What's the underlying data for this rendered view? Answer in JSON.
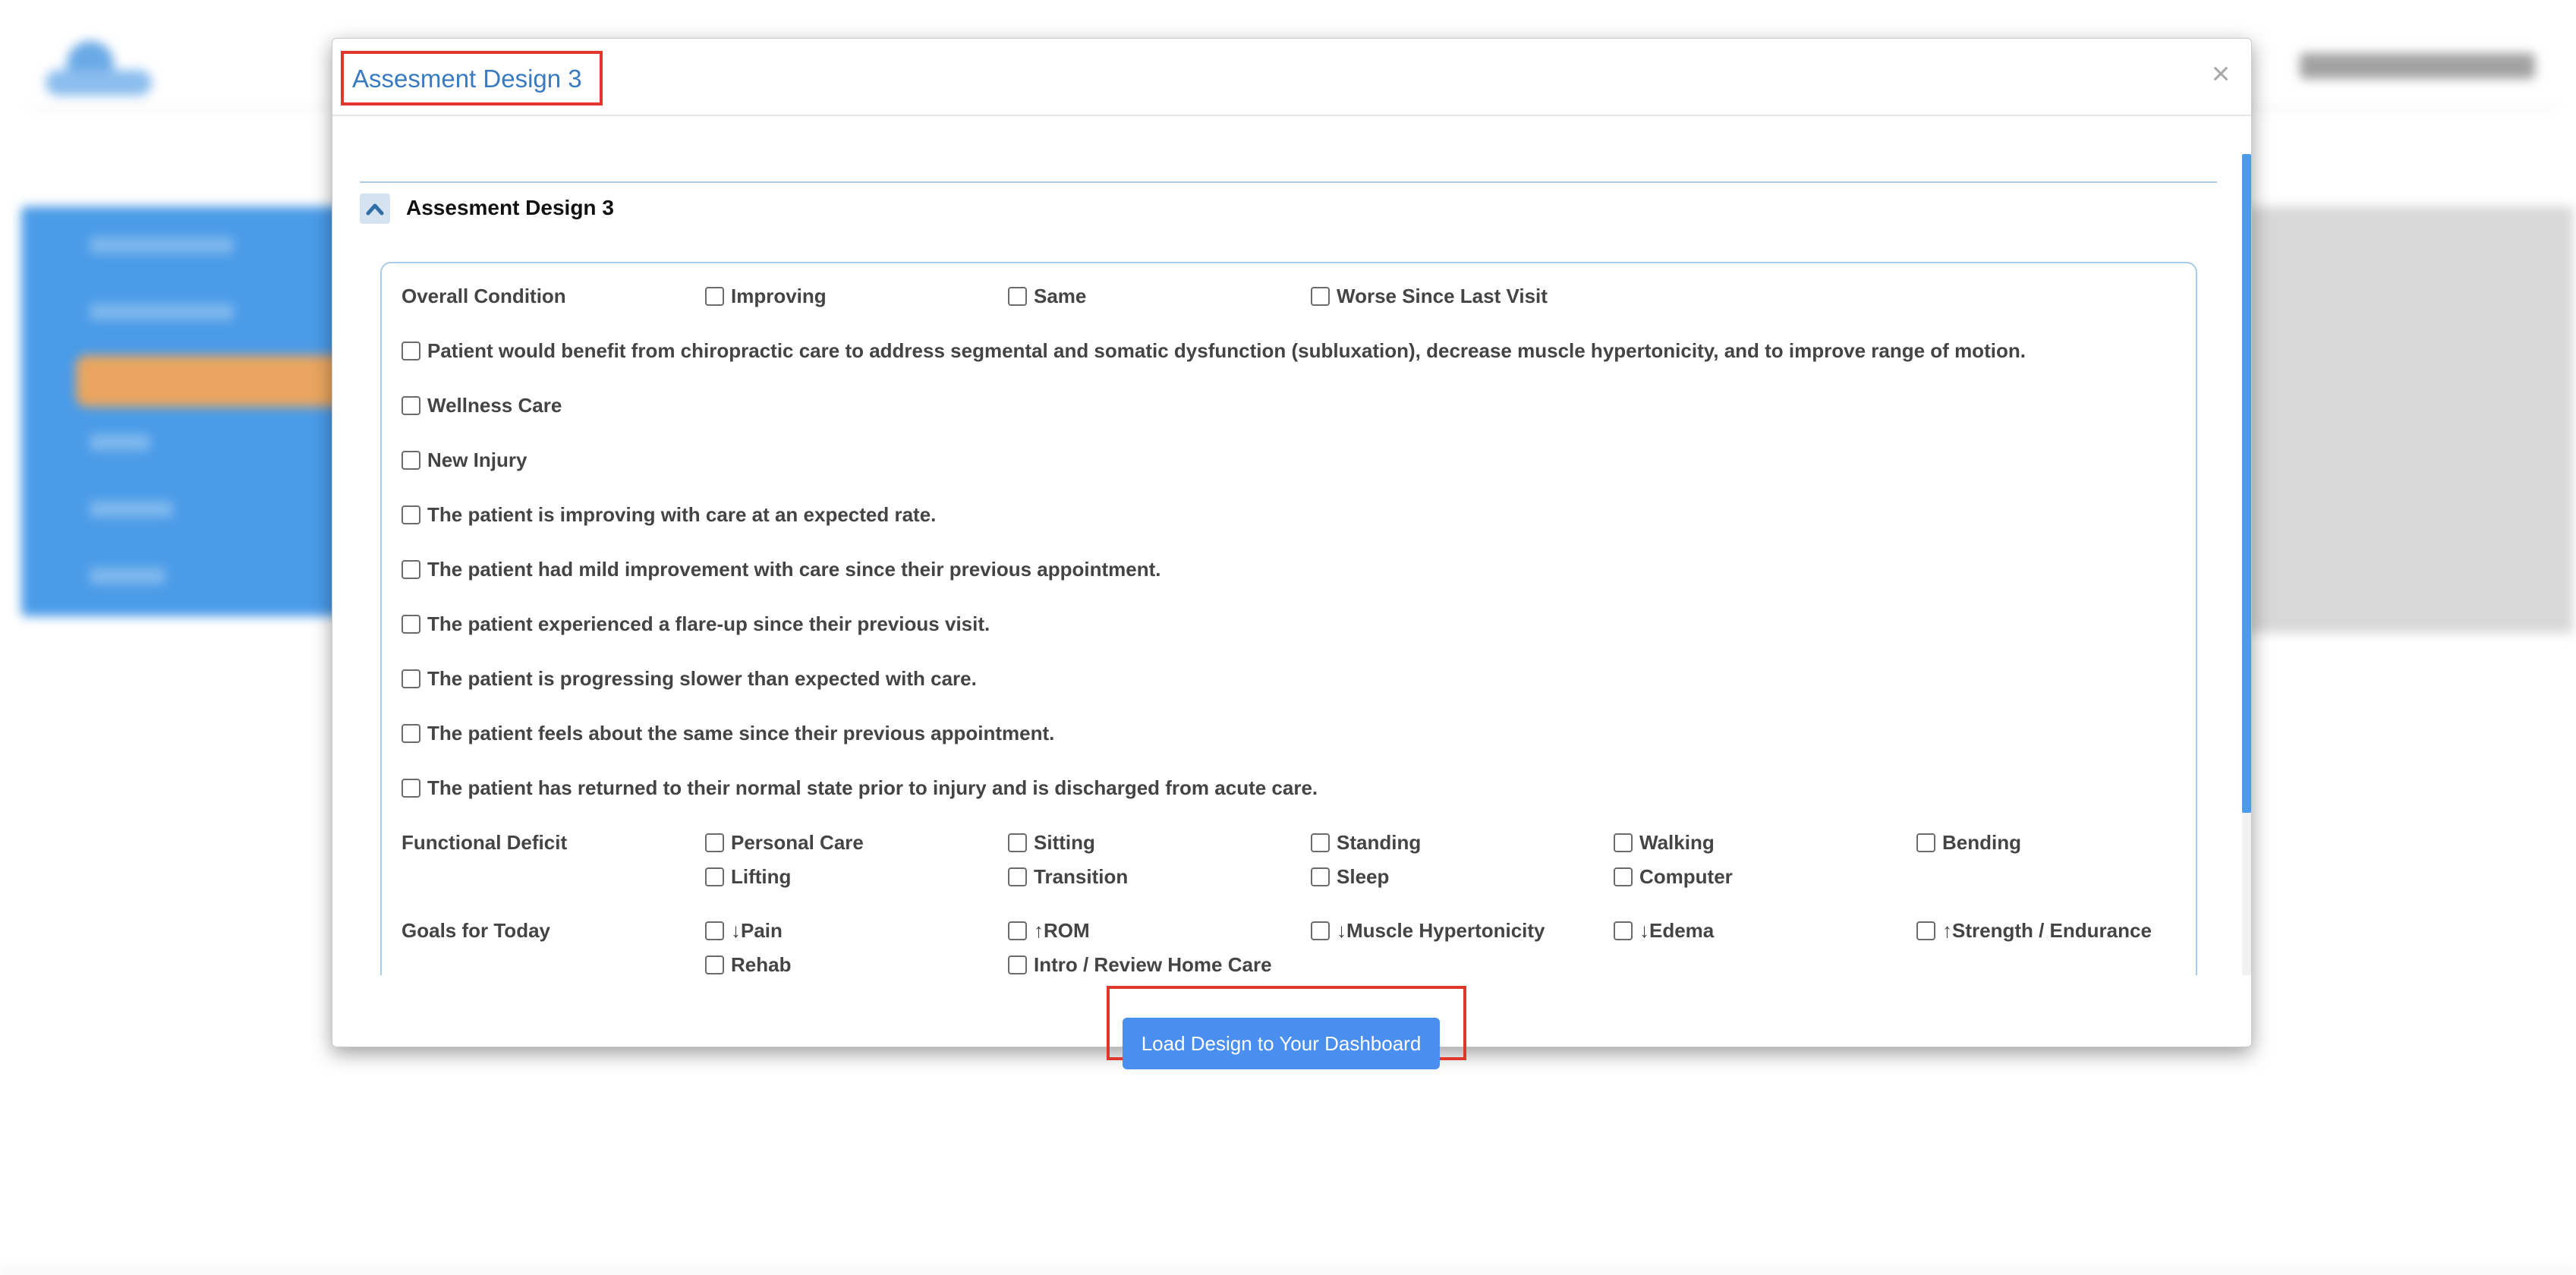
{
  "modal": {
    "title": "Assesment Design 3",
    "close_label": "×",
    "load_button_label": "Load Design to Your Dashboard"
  },
  "panel": {
    "heading": "Assesment Design 3",
    "collapse_icon": "chevron-up-icon"
  },
  "form": {
    "overall_condition": {
      "label": "Overall Condition",
      "options": [
        "Improving",
        "Same",
        "Worse Since Last Visit"
      ]
    },
    "statements": [
      "Patient would benefit from chiropractic care to address segmental and somatic dysfunction (subluxation), decrease muscle hypertonicity, and to improve range of motion.",
      "Wellness Care",
      "New Injury",
      "The patient is improving with care at an expected rate.",
      "The patient had mild improvement with care since their previous appointment.",
      "The patient experienced a flare-up since their previous visit.",
      "The patient is progressing slower than expected with care.",
      "The patient feels about the same since their previous appointment.",
      "The patient has returned to their normal state prior to injury and is discharged from acute care."
    ],
    "functional_deficit": {
      "label": "Functional Deficit",
      "options": [
        "Personal Care",
        "Sitting",
        "Standing",
        "Walking",
        "Bending",
        "Lifting",
        "Transition",
        "Sleep",
        "Computer"
      ]
    },
    "goals_for_today": {
      "label": "Goals for Today",
      "options": [
        "↓Pain",
        "↑ROM",
        "↓Muscle Hypertonicity",
        "↓Edema",
        "↑Strength / Endurance",
        "Rehab",
        "Intro / Review Home Care"
      ]
    }
  },
  "colors": {
    "accent": "#4a8ef0",
    "title": "#3a7bc0",
    "highlight": "#e0362c",
    "panel_border": "#a9cbe6"
  }
}
